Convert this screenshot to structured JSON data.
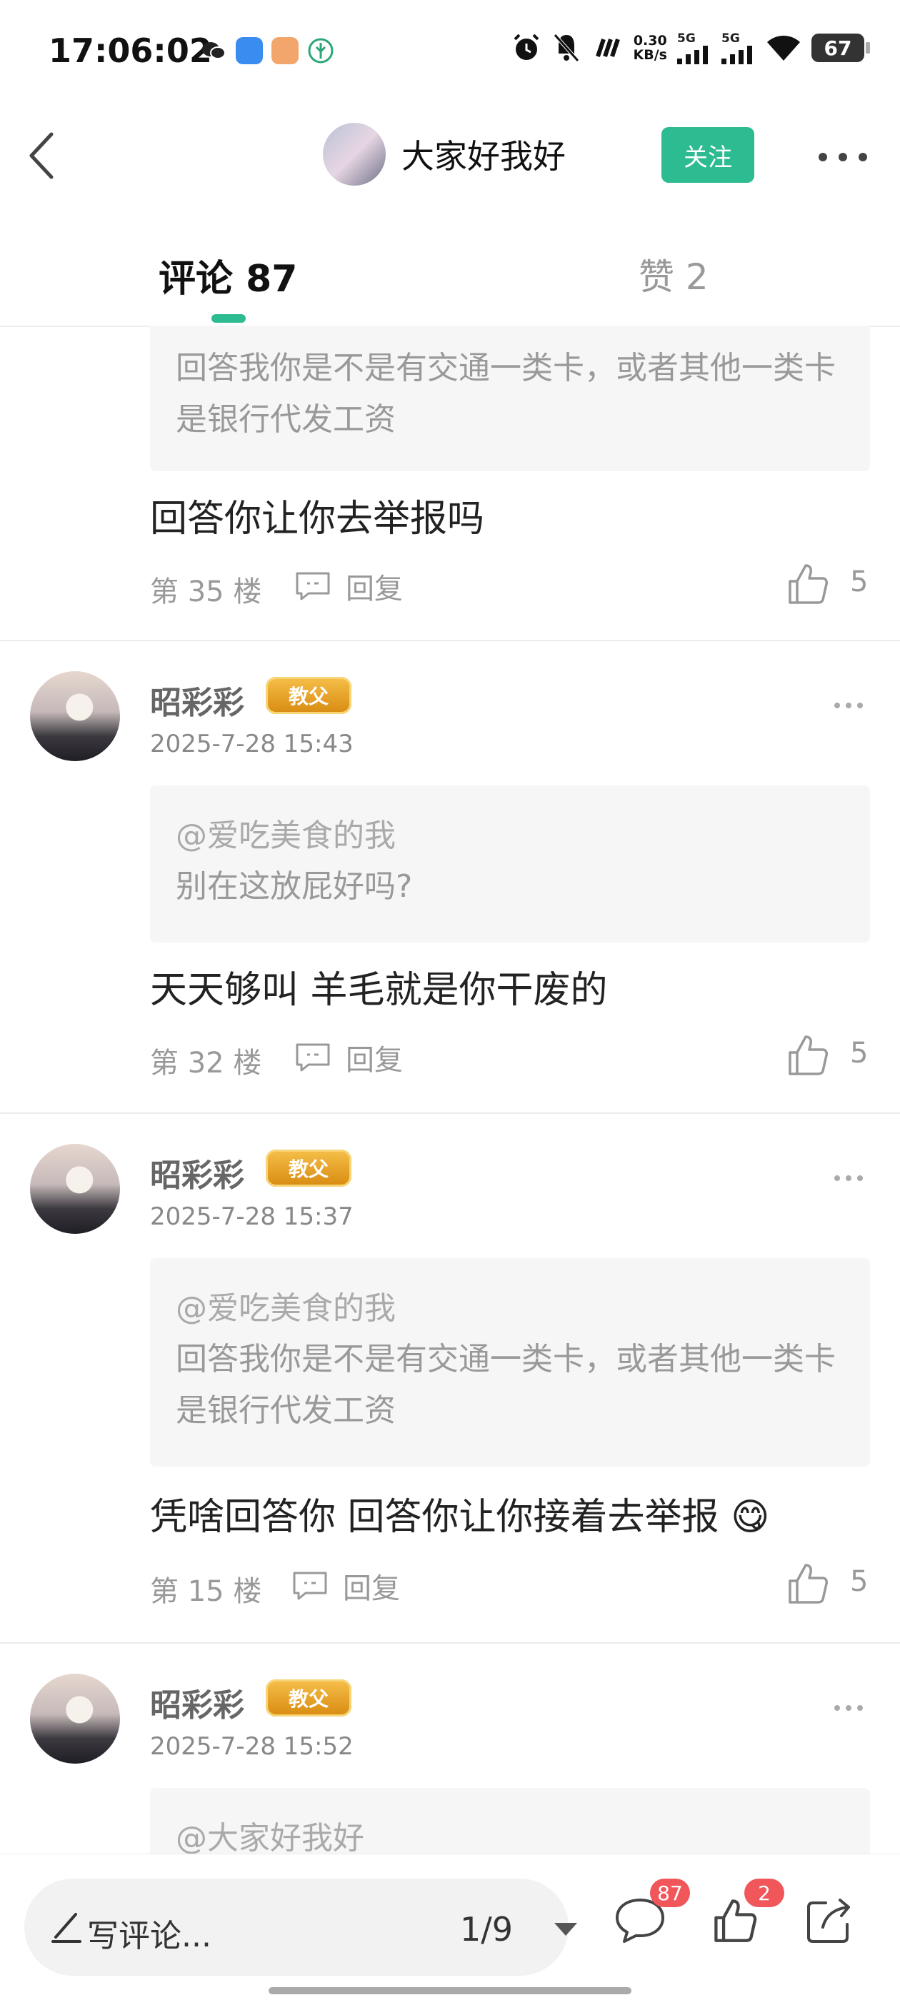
{
  "status_bar": {
    "time": "17:06:02",
    "net_speed": "0.30",
    "net_unit": "KB/s",
    "sim1": "5G",
    "sim2": "5G",
    "battery": "67"
  },
  "header": {
    "author_name": "大家好我好",
    "follow_label": "关注"
  },
  "tabs": {
    "comments_label": "评论 87",
    "likes_label": "赞 2"
  },
  "comments": [
    {
      "quote_text": "回答我你是不是有交通一类卡，或者其他一类卡是银行代发工资",
      "body": "回答你让你去举报吗",
      "floor": "第 35 楼",
      "reply_label": "回复",
      "likes": "5"
    },
    {
      "username": "昭彩彩",
      "badge": "教父",
      "time": "2025-7-28 15:43",
      "quote_at": "@爱吃美食的我",
      "quote_text": "别在这放屁好吗?",
      "body": "天天够叫 羊毛就是你干废的",
      "floor": "第 32 楼",
      "reply_label": "回复",
      "likes": "5"
    },
    {
      "username": "昭彩彩",
      "badge": "教父",
      "time": "2025-7-28 15:37",
      "quote_at": "@爱吃美食的我",
      "quote_text": "回答我你是不是有交通一类卡，或者其他一类卡是银行代发工资",
      "body": "凭啥回答你 回答你让你接着去举报",
      "body_emoji": "😋",
      "floor": "第 15 楼",
      "reply_label": "回复",
      "likes": "5"
    },
    {
      "username": "昭彩彩",
      "badge": "教父",
      "time": "2025-7-28 15:52",
      "quote_at": "@大家好我好"
    }
  ],
  "bottom_bar": {
    "compose_placeholder": "写评论...",
    "pager": "1/9",
    "comment_count": "87",
    "like_count": "2"
  },
  "colors": {
    "accent": "#2dbb91",
    "badge_red": "#f0565a",
    "badge_gold": "#e4a224"
  }
}
